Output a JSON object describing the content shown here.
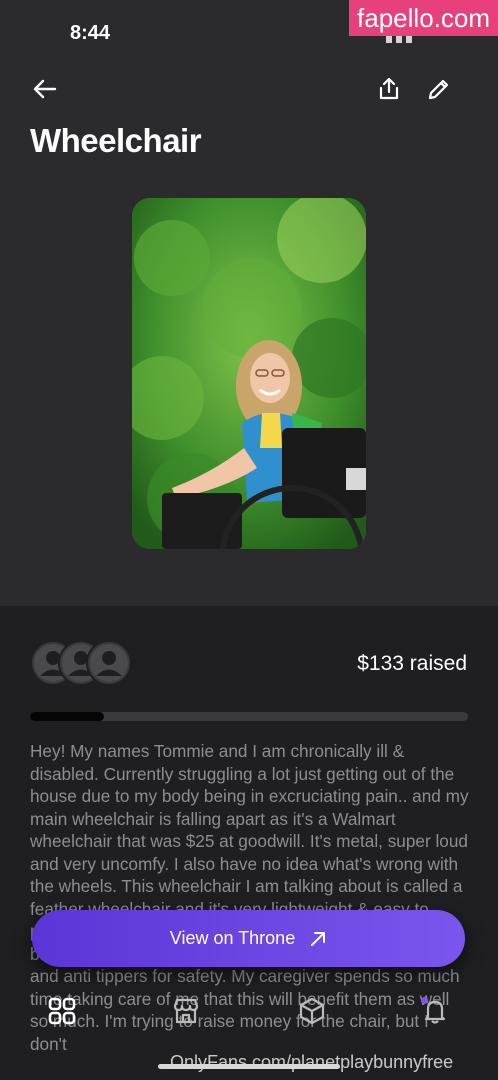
{
  "status_bar": {
    "time": "8:44"
  },
  "watermark": {
    "text": "fapello.com"
  },
  "header": {
    "title": "Wheelchair"
  },
  "icons": {
    "back": "back-arrow-icon",
    "share": "share-icon",
    "edit": "pencil-icon",
    "external": "arrow-up-right-icon"
  },
  "fundraiser": {
    "raised_text": "$133 raised",
    "progress_fraction": 0.17,
    "description": "Hey! My names Tommie and I am chronically ill & disabled. Currently struggling a lot just getting out of the house due to my body being in excruciating pain.. and my main wheelchair is falling apart as it's a Walmart wheelchair that was $25 at goodwill. It's metal, super loud  and very uncomfy. I also have no idea what's wrong with the wheels. This wheelchair I am talking about is called a feather wheelchair and it's very lightweight & easy to push. I'm also getting cushions, a bag to hang off the back for my caregiver, straps for my feet not to fall off, and anti tippers for safety. My caregiver spends so much time taking care of me that this will benefit them as well so much. I'm trying to raise money for the chair, but I don't"
  },
  "cta": {
    "label": "View on Throne"
  },
  "tab_bar": {
    "items": [
      "grid-icon",
      "storefront-icon",
      "cube-icon",
      "bell-icon"
    ]
  },
  "footer_watermark": {
    "text": "OnlyFans.com/planetplaybunnyfree"
  },
  "colors": {
    "background": "#2b2b2d",
    "panel": "#1f1f21",
    "accent": "#6a46e4",
    "text_muted": "#8e8e92"
  }
}
